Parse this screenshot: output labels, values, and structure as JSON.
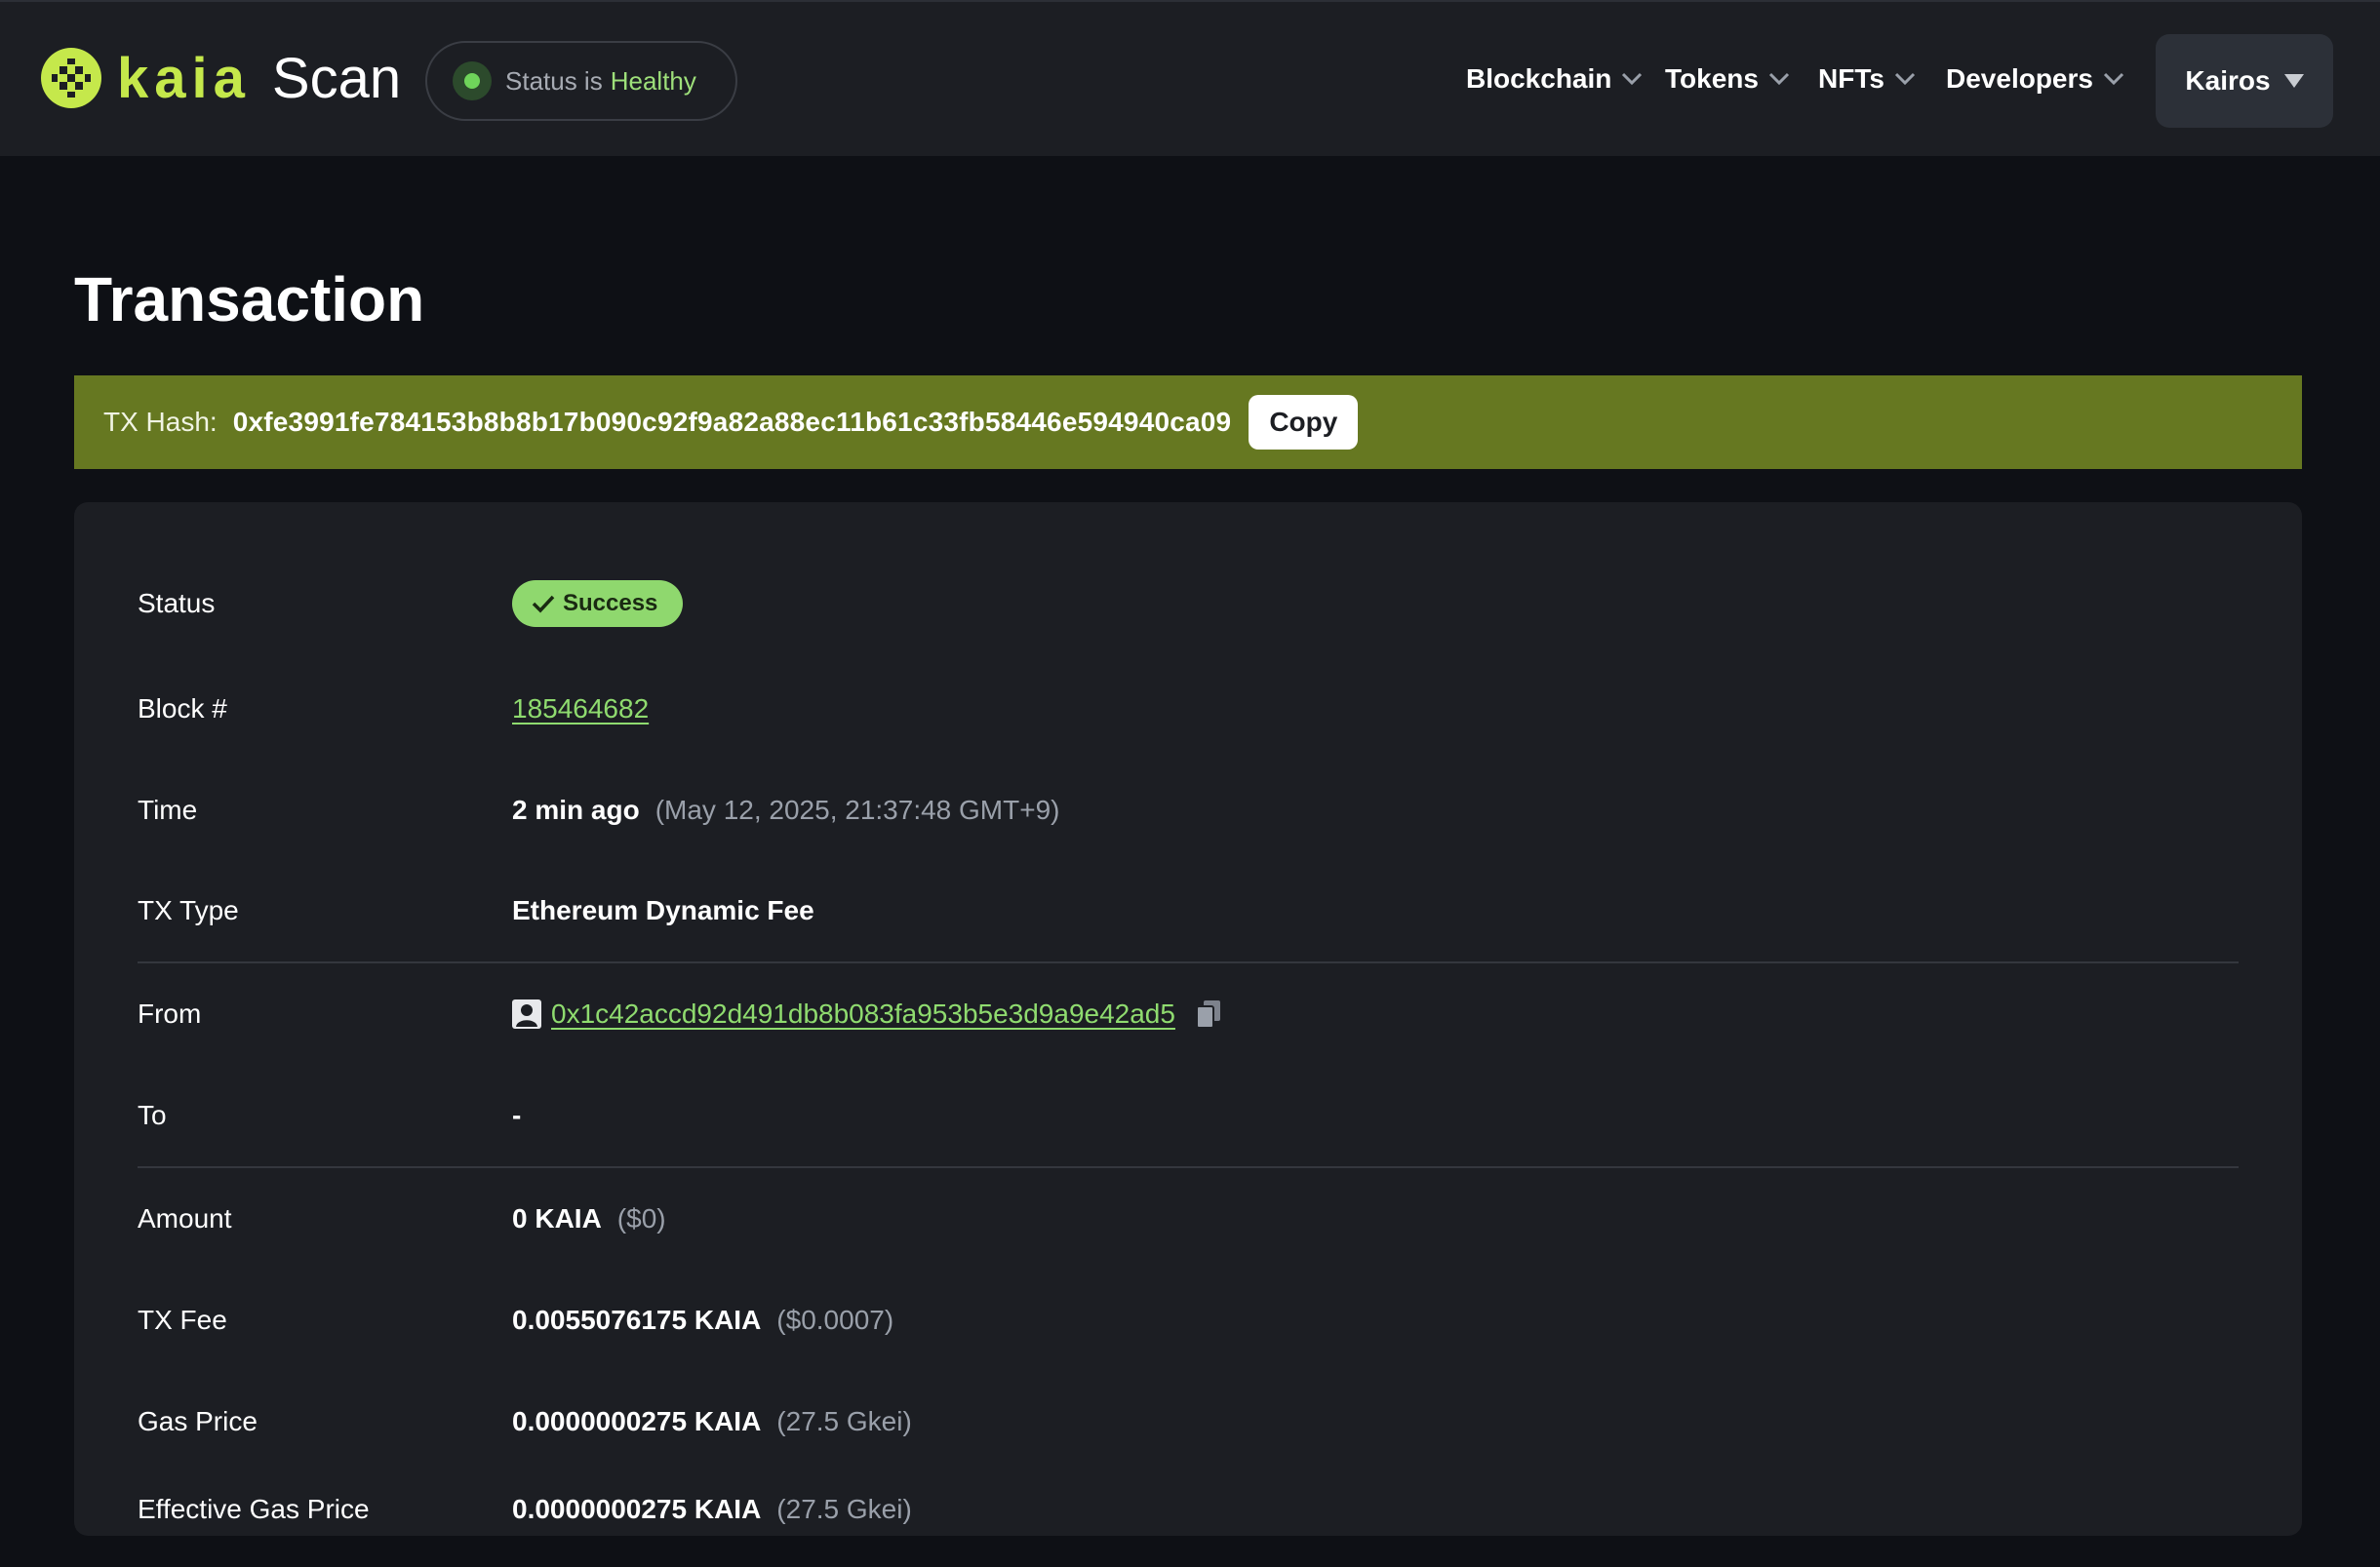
{
  "header": {
    "logo_text": "kaia",
    "logo_suffix": "Scan",
    "status_prefix": "Status is",
    "status_value": "Healthy",
    "nav": [
      "Blockchain",
      "Tokens",
      "NFTs",
      "Developers"
    ],
    "network": "Kairos"
  },
  "page": {
    "title": "Transaction",
    "hash_label": "TX Hash:",
    "hash_value": "0xfe3991fe784153b8b8b17b090c92f9a82a88ec11b61c33fb58446e594940ca09",
    "copy_label": "Copy"
  },
  "details": {
    "status": {
      "label": "Status",
      "value": "Success"
    },
    "block": {
      "label": "Block #",
      "value": "185464682"
    },
    "time": {
      "label": "Time",
      "value": "2 min ago",
      "extra": "(May 12, 2025, 21:37:48 GMT+9)"
    },
    "tx_type": {
      "label": "TX Type",
      "value": "Ethereum Dynamic Fee"
    },
    "from": {
      "label": "From",
      "value": "0x1c42accd92d491db8b083fa953b5e3d9a9e42ad5"
    },
    "to": {
      "label": "To",
      "value": "-"
    },
    "amount": {
      "label": "Amount",
      "value": "0 KAIA",
      "extra": "($0)"
    },
    "tx_fee": {
      "label": "TX Fee",
      "value": "0.0055076175 KAIA",
      "extra": "($0.0007)"
    },
    "gas_price": {
      "label": "Gas Price",
      "value": "0.0000000275 KAIA",
      "extra": "(27.5 Gkei)"
    },
    "effective_gas_price": {
      "label": "Effective Gas Price",
      "value": "0.0000000275 KAIA",
      "extra": "(27.5 Gkei)"
    }
  },
  "colors": {
    "accent": "#c5e84b",
    "hash_bar": "#667821",
    "success": "#8fd86e",
    "link": "#8fdb6f",
    "background": "#0e1015",
    "card": "#1c1e23"
  }
}
